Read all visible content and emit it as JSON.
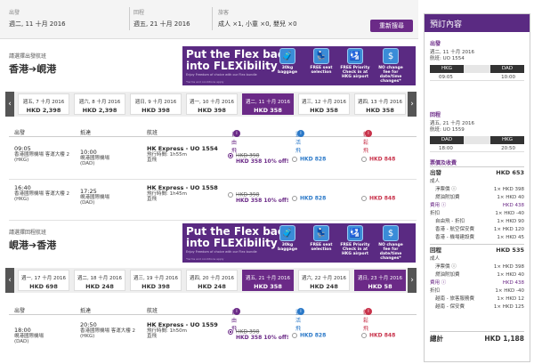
{
  "search": {
    "depart_label": "出發",
    "depart_val": "週二, 11 十月 2016",
    "return_label": "回程",
    "return_val": "週五, 21 十月 2016",
    "pax_label": "旅客",
    "pax_val": "成人 ×1, 小童 ×0, 嬰兒 ×0",
    "button": "重新搜尋"
  },
  "banner": {
    "title_1": "Put the Flex back",
    "title_2": "into FLEXibility",
    "fine": "Enjoy Freedom of choice with our Flex bundle",
    "small": "*terms and conditions apply",
    "features": [
      {
        "icon": "luggage-icon",
        "glyph": "🧳",
        "text": "30kg baggage"
      },
      {
        "icon": "seat-icon",
        "glyph": "💺",
        "text": "FREE seat selection"
      },
      {
        "icon": "checkin-icon",
        "glyph": "🛂",
        "text": "FREE Priority Check in at HKG airport"
      },
      {
        "icon": "no-fee-icon",
        "glyph": "$",
        "text": "NO change fee for date/time changes*"
      }
    ]
  },
  "outbound": {
    "pre": "請選擇出發航班",
    "from": "香港",
    "to": "峴港",
    "dates": [
      {
        "d": "週五, 7 十月 2016",
        "p": "HKD 2,398"
      },
      {
        "d": "週六, 8 十月 2016",
        "p": "HKD 2,398"
      },
      {
        "d": "週日, 9 十月 2016",
        "p": "HKD 398"
      },
      {
        "d": "週一, 10 十月 2016",
        "p": "HKD 398"
      },
      {
        "d": "週二, 11 十月 2016",
        "p": "HKD 358"
      },
      {
        "d": "週三, 12 十月 2016",
        "p": "HKD 358"
      },
      {
        "d": "週四, 13 十月 2016",
        "p": "HKD 358"
      }
    ],
    "flights": [
      {
        "dep_time": "09:05",
        "dep_ap": "香港國際機場 客運大樓 2",
        "dep_code": "(HKG)",
        "arr_time": "10:00",
        "arr_ap": "峴港國際機場",
        "arr_code": "(DAD)",
        "fno": "HK Express - UO 1554",
        "dur": "飛行時間: 1h55m",
        "stops": "直飛",
        "old": "HKD 398",
        "promo": "HKD 358 10% off!",
        "flex": "HKD 828",
        "biz": "HKD 848"
      },
      {
        "dep_time": "16:40",
        "dep_ap": "香港國際機場 客運大樓 2",
        "dep_code": "(HKG)",
        "arr_time": "17:25",
        "arr_ap": "峴港國際機場",
        "arr_code": "(DAD)",
        "fno": "HK Express - UO 1558",
        "dur": "飛行時間: 1h45m",
        "stops": "直飛",
        "old": "HKD 398",
        "promo": "HKD 358 10% off!",
        "flex": "HKD 828",
        "biz": "HKD 848"
      }
    ]
  },
  "inbound": {
    "pre": "請選擇回程航班",
    "from": "峴港",
    "to": "香港",
    "dates": [
      {
        "d": "週一, 17 十月 2016",
        "p": "HKD 698"
      },
      {
        "d": "週二, 18 十月 2016",
        "p": "HKD 248"
      },
      {
        "d": "週三, 19 十月 2016",
        "p": "HKD 398"
      },
      {
        "d": "週四, 20 十月 2016",
        "p": "HKD 248"
      },
      {
        "d": "週五, 21 十月 2016",
        "p": "HKD 358"
      },
      {
        "d": "週六, 22 十月 2016",
        "p": "HKD 248"
      },
      {
        "d": "週日, 23 十月 2016",
        "p": "HKD 58"
      }
    ],
    "flights": [
      {
        "dep_time": "18:00",
        "dep_ap": "峴港國際機場",
        "dep_code": "(DAD)",
        "arr_time": "20:50",
        "arr_ap": "香港國際機場 客運大樓 2",
        "arr_code": "(HKG)",
        "fno": "HK Express - UO 1559",
        "dur": "飛行時間: 1h50m",
        "stops": "直飛",
        "old": "HKD 398",
        "promo": "HKD 358 10% off!",
        "flex": "HKD 828",
        "biz": "HKD 848"
      }
    ]
  },
  "columns": {
    "depart": "出發",
    "arrive": "抵達",
    "flight": "航班",
    "fun": "自由飛",
    "flex": "靈活飛",
    "biz": "輕鬆飛"
  },
  "sidebar": {
    "title": "預訂內容",
    "out_label": "出發",
    "out_date": "週二, 11 十月 2016",
    "out_flight": "航班: UO 1554",
    "out_from": "HKG",
    "out_to": "DAD",
    "out_dep": "09:05",
    "out_arr": "10:00",
    "in_label": "回程",
    "in_date": "週五, 21 十月 2016",
    "in_flight": "航班: UO 1559",
    "in_from": "DAD",
    "in_to": "HKG",
    "in_dep": "18:00",
    "in_arr": "20:50",
    "fare_title": "票價及收費",
    "out_sec": "出發",
    "out_total": "HKD 653",
    "rows_out": [
      {
        "l": "成人",
        "r": ""
      },
      {
        "l": "淨票價 ⓘ",
        "r": "1× HKD 398"
      },
      {
        "l": "燃油附加費",
        "r": "1× HKD 40"
      },
      {
        "l": "費用 ⓘ",
        "r": "HKD 438"
      },
      {
        "l": "折扣",
        "r": "1× HKD -40"
      },
      {
        "l": "自由飛 - 折扣",
        "r": "1× HKD 90"
      },
      {
        "l": "香港 - 航空保安費",
        "r": "1× HKD 120"
      },
      {
        "l": "香港 - 機場建設費",
        "r": "1× HKD 45"
      }
    ],
    "in_sec": "回程",
    "in_total": "HKD 535",
    "rows_in": [
      {
        "l": "成人",
        "r": ""
      },
      {
        "l": "淨票價 ⓘ",
        "r": "1× HKD 398"
      },
      {
        "l": "燃油附加費",
        "r": "1× HKD 40"
      },
      {
        "l": "費用 ⓘ",
        "r": "HKD 438"
      },
      {
        "l": "折扣",
        "r": "1× HKD -40"
      },
      {
        "l": "越南 - 旅客服務費",
        "r": "1× HKD 12"
      },
      {
        "l": "越南 - 保安費",
        "r": "1× HKD 125"
      }
    ],
    "total_label": "總計",
    "total": "HKD 1,188"
  },
  "colors": {
    "primary": "#6b2a87",
    "banner": "#5a2a82",
    "blue": "#2a78c8",
    "red": "#c8324a"
  }
}
